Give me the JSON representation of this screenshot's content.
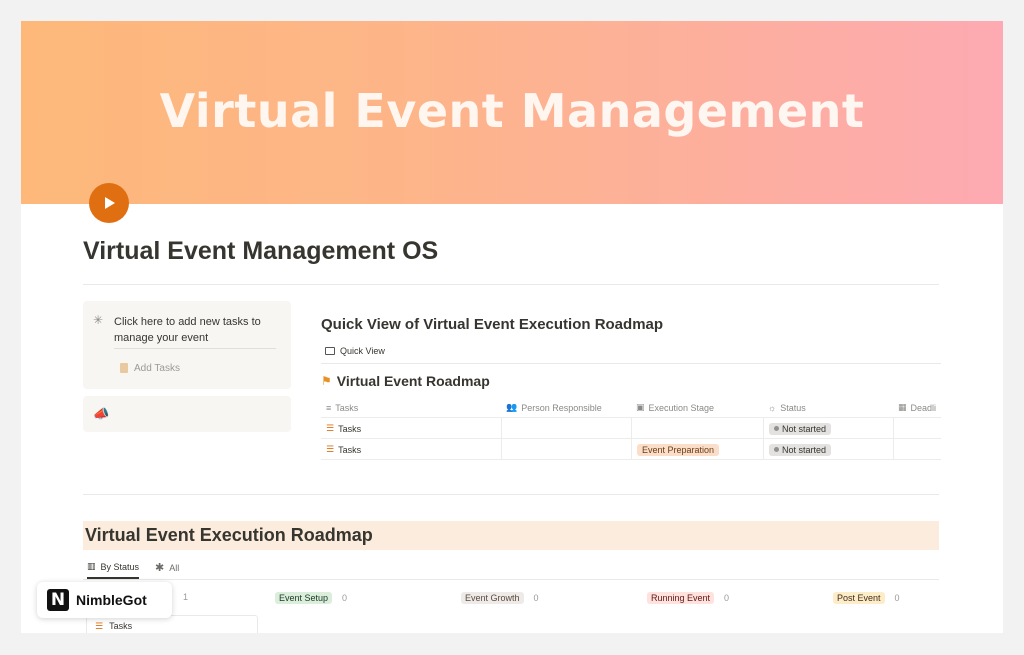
{
  "cover": {
    "title": "Virtual Event Management"
  },
  "page": {
    "title": "Virtual Event Management OS"
  },
  "callout1": {
    "text": "Click here to add new tasks to manage your event",
    "button": "Add Tasks"
  },
  "quick_view": {
    "title": "Quick View of Virtual Event Execution Roadmap",
    "tab": "Quick View",
    "db_title": "Virtual Event Roadmap",
    "columns": [
      "Tasks",
      "Person Responsible",
      "Execution Stage",
      "Status",
      "Deadli"
    ],
    "rows": [
      {
        "task": "Tasks",
        "person": "",
        "stage": "",
        "status": "Not started"
      },
      {
        "task": "Tasks",
        "person": "",
        "stage": "Event Preparation",
        "status": "Not started"
      }
    ]
  },
  "roadmap": {
    "title": "Virtual Event Execution Roadmap",
    "tabs": [
      "By Status",
      "All"
    ],
    "groups": [
      {
        "name": "",
        "count": "1"
      },
      {
        "name": "Event Setup",
        "count": "0"
      },
      {
        "name": "Event Growth",
        "count": "0"
      },
      {
        "name": "Running Event",
        "count": "0"
      },
      {
        "name": "Post Event",
        "count": "0"
      }
    ],
    "card": "Tasks"
  },
  "brand": {
    "mark": "N",
    "name": "NimbleGot"
  },
  "colors": {
    "accent": "#e06f12",
    "section_bg": "#fbecdd"
  }
}
